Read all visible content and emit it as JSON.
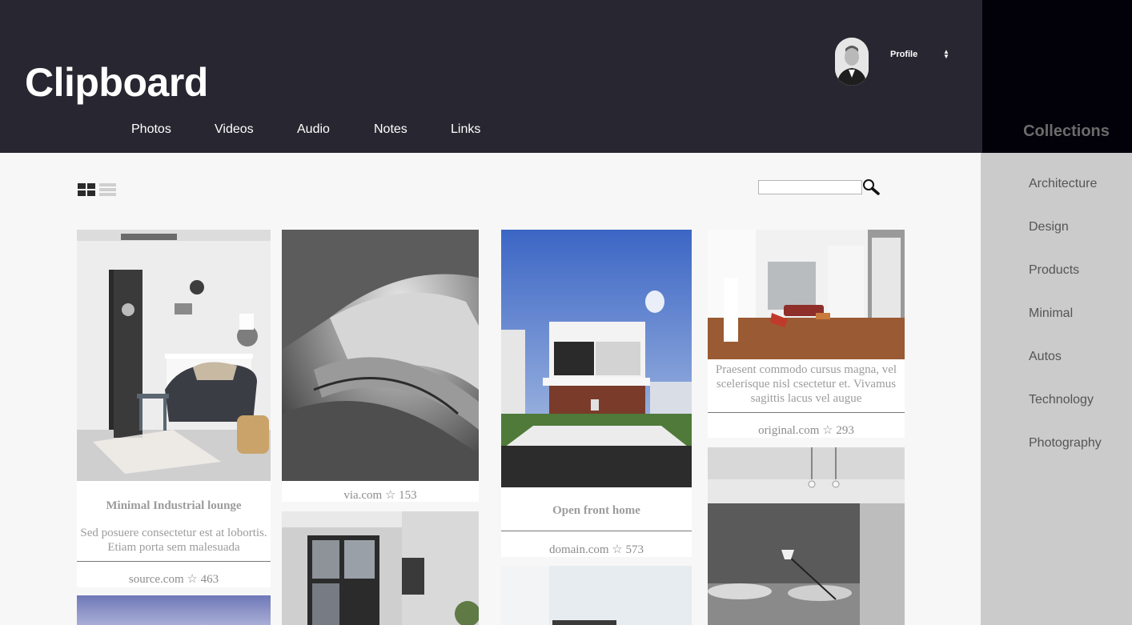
{
  "app": {
    "title": "Clipboard"
  },
  "nav": [
    {
      "label": "Photos"
    },
    {
      "label": "Videos"
    },
    {
      "label": "Audio"
    },
    {
      "label": "Notes"
    },
    {
      "label": "Links"
    }
  ],
  "profile": {
    "label": "Profile"
  },
  "sidebar": {
    "title": "Collections",
    "items": [
      {
        "label": "Architecture"
      },
      {
        "label": "Design"
      },
      {
        "label": "Products"
      },
      {
        "label": "Minimal"
      },
      {
        "label": "Autos"
      },
      {
        "label": "Technology"
      },
      {
        "label": "Photography"
      }
    ]
  },
  "search": {
    "placeholder": ""
  },
  "cards": {
    "lounge": {
      "title": "Minimal Industrial lounge",
      "desc": "Sed posuere consectetur est at lobortis. Etiam porta sem malesuada",
      "meta": "source.com ☆ 463"
    },
    "stairs": {
      "meta": "via.com ☆ 153"
    },
    "house": {
      "title": "Open front home",
      "meta": "domain.com ☆ 573"
    },
    "interior": {
      "desc": "Praesent commodo cursus magna, vel scelerisque nisl csectetur et. Vivamus sagittis lacus vel augue",
      "meta": "original.com ☆ 293"
    }
  },
  "colors": {
    "header": "#282630",
    "sidebar_top": "#02010a",
    "sidebar": "#cbcbcb",
    "background": "#f7f7f7"
  }
}
